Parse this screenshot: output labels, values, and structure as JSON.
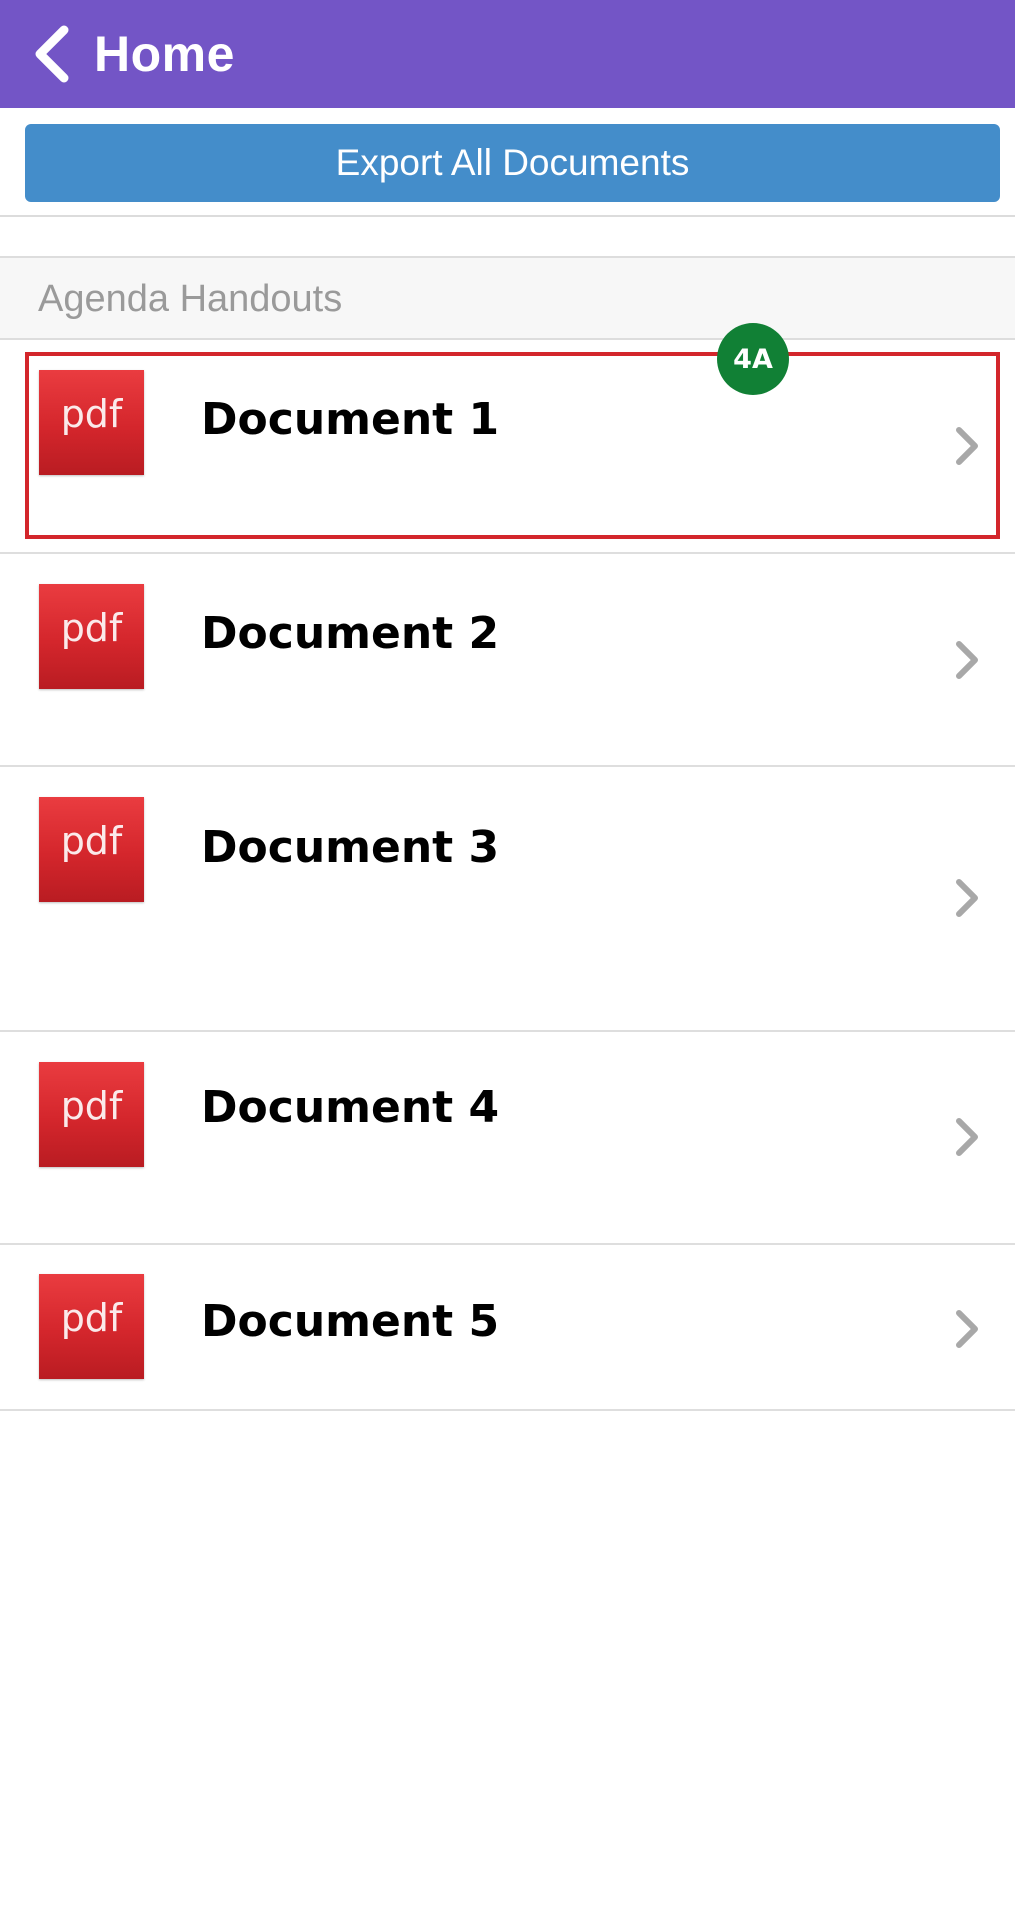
{
  "header": {
    "back_label": "Home",
    "back_icon": "chevron-left-icon",
    "background": "#7355c6"
  },
  "export_button": {
    "label": "Export All Documents",
    "color": "#448dca"
  },
  "section": {
    "title": "Agenda Handouts"
  },
  "documents": [
    {
      "title": "Document 1",
      "icon_label": "pdf"
    },
    {
      "title": "Document 2",
      "icon_label": "pdf"
    },
    {
      "title": "Document 3",
      "icon_label": "pdf"
    },
    {
      "title": "Document 4",
      "icon_label": "pdf"
    },
    {
      "title": "Document 5",
      "icon_label": "pdf"
    }
  ],
  "annotation": {
    "badge": "4A",
    "badge_color": "#118035",
    "highlight_color": "#d3262b"
  }
}
